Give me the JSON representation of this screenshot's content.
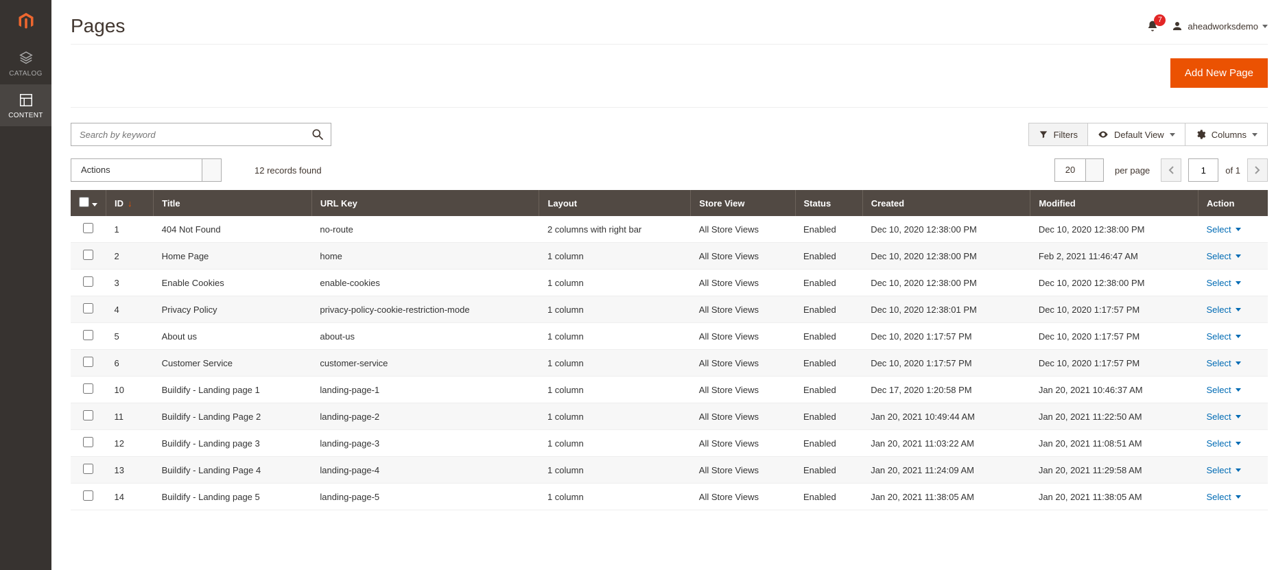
{
  "page": {
    "title": "Pages"
  },
  "user": {
    "name": "aheadworksdemo",
    "notifications": "7"
  },
  "sidebar": {
    "items": [
      {
        "label": "CATALOG",
        "icon": "catalog",
        "active": false
      },
      {
        "label": "CONTENT",
        "icon": "content",
        "active": true
      }
    ]
  },
  "buttons": {
    "add_new_page": "Add New Page"
  },
  "search": {
    "placeholder": "Search by keyword"
  },
  "toolbar": {
    "filters": "Filters",
    "default_view": "Default View",
    "columns": "Columns"
  },
  "actions": {
    "label": "Actions"
  },
  "records": {
    "text": "12 records found"
  },
  "pagination": {
    "per_page": "20",
    "per_page_label": "per page",
    "page": "1",
    "of_label": "of",
    "total": "1"
  },
  "grid": {
    "headers": {
      "id": "ID",
      "title": "Title",
      "url_key": "URL Key",
      "layout": "Layout",
      "store_view": "Store View",
      "status": "Status",
      "created": "Created",
      "modified": "Modified",
      "action": "Action"
    },
    "row_action": "Select",
    "rows": [
      {
        "id": "1",
        "title": "404 Not Found",
        "url_key": "no-route",
        "layout": "2 columns with right bar",
        "store_view": "All Store Views",
        "status": "Enabled",
        "created": "Dec 10, 2020 12:38:00 PM",
        "modified": "Dec 10, 2020 12:38:00 PM"
      },
      {
        "id": "2",
        "title": "Home Page",
        "url_key": "home",
        "layout": "1 column",
        "store_view": "All Store Views",
        "status": "Enabled",
        "created": "Dec 10, 2020 12:38:00 PM",
        "modified": "Feb 2, 2021 11:46:47 AM"
      },
      {
        "id": "3",
        "title": "Enable Cookies",
        "url_key": "enable-cookies",
        "layout": "1 column",
        "store_view": "All Store Views",
        "status": "Enabled",
        "created": "Dec 10, 2020 12:38:00 PM",
        "modified": "Dec 10, 2020 12:38:00 PM"
      },
      {
        "id": "4",
        "title": "Privacy Policy",
        "url_key": "privacy-policy-cookie-restriction-mode",
        "layout": "1 column",
        "store_view": "All Store Views",
        "status": "Enabled",
        "created": "Dec 10, 2020 12:38:01 PM",
        "modified": "Dec 10, 2020 1:17:57 PM"
      },
      {
        "id": "5",
        "title": "About us",
        "url_key": "about-us",
        "layout": "1 column",
        "store_view": "All Store Views",
        "status": "Enabled",
        "created": "Dec 10, 2020 1:17:57 PM",
        "modified": "Dec 10, 2020 1:17:57 PM"
      },
      {
        "id": "6",
        "title": "Customer Service",
        "url_key": "customer-service",
        "layout": "1 column",
        "store_view": "All Store Views",
        "status": "Enabled",
        "created": "Dec 10, 2020 1:17:57 PM",
        "modified": "Dec 10, 2020 1:17:57 PM"
      },
      {
        "id": "10",
        "title": "Buildify - Landing page 1",
        "url_key": "landing-page-1",
        "layout": "1 column",
        "store_view": "All Store Views",
        "status": "Enabled",
        "created": "Dec 17, 2020 1:20:58 PM",
        "modified": "Jan 20, 2021 10:46:37 AM"
      },
      {
        "id": "11",
        "title": "Buildify - Landing Page 2",
        "url_key": "landing-page-2",
        "layout": "1 column",
        "store_view": "All Store Views",
        "status": "Enabled",
        "created": "Jan 20, 2021 10:49:44 AM",
        "modified": "Jan 20, 2021 11:22:50 AM"
      },
      {
        "id": "12",
        "title": "Buildify - Landing page 3",
        "url_key": "landing-page-3",
        "layout": "1 column",
        "store_view": "All Store Views",
        "status": "Enabled",
        "created": "Jan 20, 2021 11:03:22 AM",
        "modified": "Jan 20, 2021 11:08:51 AM"
      },
      {
        "id": "13",
        "title": "Buildify - Landing Page 4",
        "url_key": "landing-page-4",
        "layout": "1 column",
        "store_view": "All Store Views",
        "status": "Enabled",
        "created": "Jan 20, 2021 11:24:09 AM",
        "modified": "Jan 20, 2021 11:29:58 AM"
      },
      {
        "id": "14",
        "title": "Buildify - Landing page 5",
        "url_key": "landing-page-5",
        "layout": "1 column",
        "store_view": "All Store Views",
        "status": "Enabled",
        "created": "Jan 20, 2021 11:38:05 AM",
        "modified": "Jan 20, 2021 11:38:05 AM"
      }
    ]
  }
}
